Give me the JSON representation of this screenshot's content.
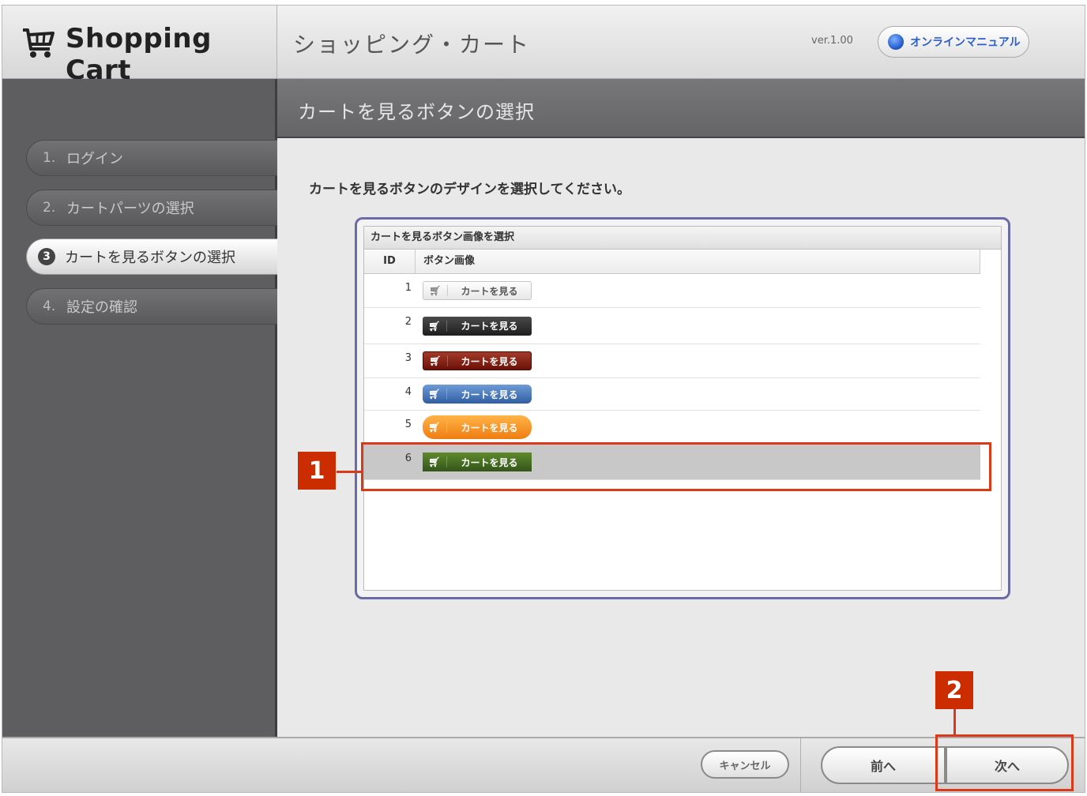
{
  "header": {
    "logo_text": "Shopping Cart",
    "title": "ショッピング・カート",
    "version": "ver.1.00",
    "manual_label": "オンラインマニュアル"
  },
  "sidebar": {
    "steps": [
      {
        "num": "1.",
        "label": "ログイン",
        "active": false
      },
      {
        "num": "2.",
        "label": "カートパーツの選択",
        "active": false
      },
      {
        "num": "3",
        "label": "カートを見るボタンの選択",
        "active": true
      },
      {
        "num": "4.",
        "label": "設定の確認",
        "active": false
      }
    ]
  },
  "content": {
    "title": "カートを見るボタンの選択",
    "instruction": "カートを見るボタンのデザインを選択してください。"
  },
  "grid": {
    "title": "カートを見るボタン画像を選択",
    "columns": [
      "ID",
      "ボタン画像"
    ],
    "rows": [
      {
        "id": "1",
        "label": "カートを見る",
        "style": "light-gray"
      },
      {
        "id": "2",
        "label": "カートを見る",
        "style": "black"
      },
      {
        "id": "3",
        "label": "カートを見る",
        "style": "dark-red"
      },
      {
        "id": "4",
        "label": "カートを見る",
        "style": "blue"
      },
      {
        "id": "5",
        "label": "カートを見る",
        "style": "orange"
      },
      {
        "id": "6",
        "label": "カートを見る",
        "style": "green",
        "selected": true
      }
    ],
    "cart_icon": "cart-icon"
  },
  "annotations": {
    "marker1": "1",
    "marker2": "2"
  },
  "footer": {
    "cancel_label": "キャンセル",
    "prev_label": "前へ",
    "next_label": "次へ"
  },
  "colors": {
    "sidebar_bg": "#5e5e60",
    "annotation_red": "#cc2d00",
    "panel_border": "#6b6ba8",
    "selected_row": "#c8c8c8",
    "manual_link": "#2b5fd0"
  }
}
